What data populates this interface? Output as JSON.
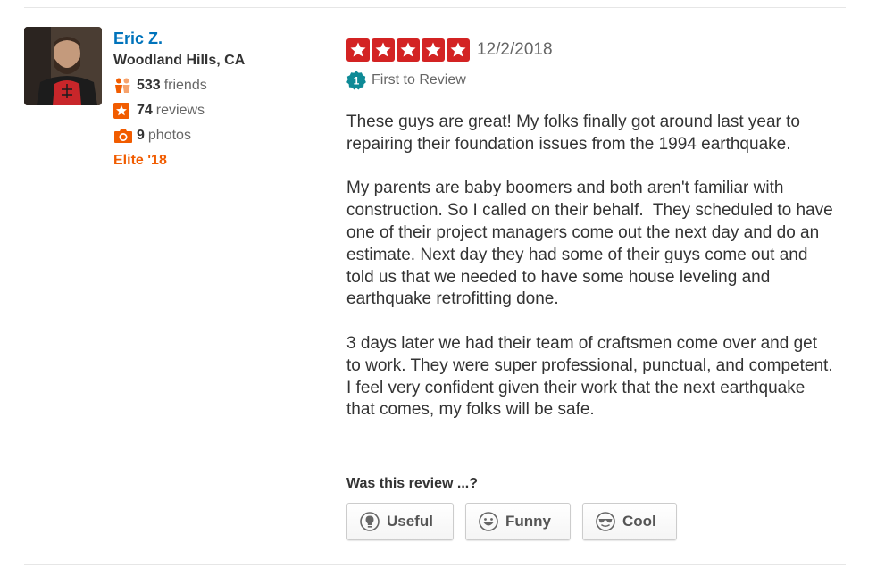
{
  "user": {
    "name": "Eric Z.",
    "location": "Woodland Hills, CA",
    "friends": {
      "count": "533",
      "label": "friends",
      "icon": "friends-icon"
    },
    "reviews": {
      "count": "74",
      "label": "reviews",
      "icon": "star-icon"
    },
    "photos": {
      "count": "9",
      "label": "photos",
      "icon": "camera-icon"
    },
    "elite": "Elite '18",
    "colors": {
      "name": "#0073bb",
      "elite": "#f15c00",
      "icon_orange": "#f15c00"
    }
  },
  "review": {
    "rating": 5,
    "max_rating": 5,
    "star_color": "#d32323",
    "date": "12/2/2018",
    "first_to_review": "First to Review",
    "badge_number": "1",
    "paragraphs": [
      "These guys are great! My folks finally got around last year to repairing their foundation issues from the 1994 earthquake.",
      "My parents are baby boomers and both aren't familiar with construction. So I called on their behalf.  They scheduled to have one of their project managers come out the next day and do an estimate. Next day they had some of their guys come out and told us that we needed to have some house leveling and earthquake retrofitting done.",
      "3 days later we had their team of craftsmen come over and get to work. They were super professional, punctual, and competent. I feel very confident given their work that the next earthquake that comes, my folks will be safe."
    ]
  },
  "feedback": {
    "question": "Was this review ...?",
    "buttons": [
      {
        "label": "Useful",
        "icon": "lightbulb-icon"
      },
      {
        "label": "Funny",
        "icon": "smile-icon"
      },
      {
        "label": "Cool",
        "icon": "sunglasses-icon"
      }
    ]
  }
}
